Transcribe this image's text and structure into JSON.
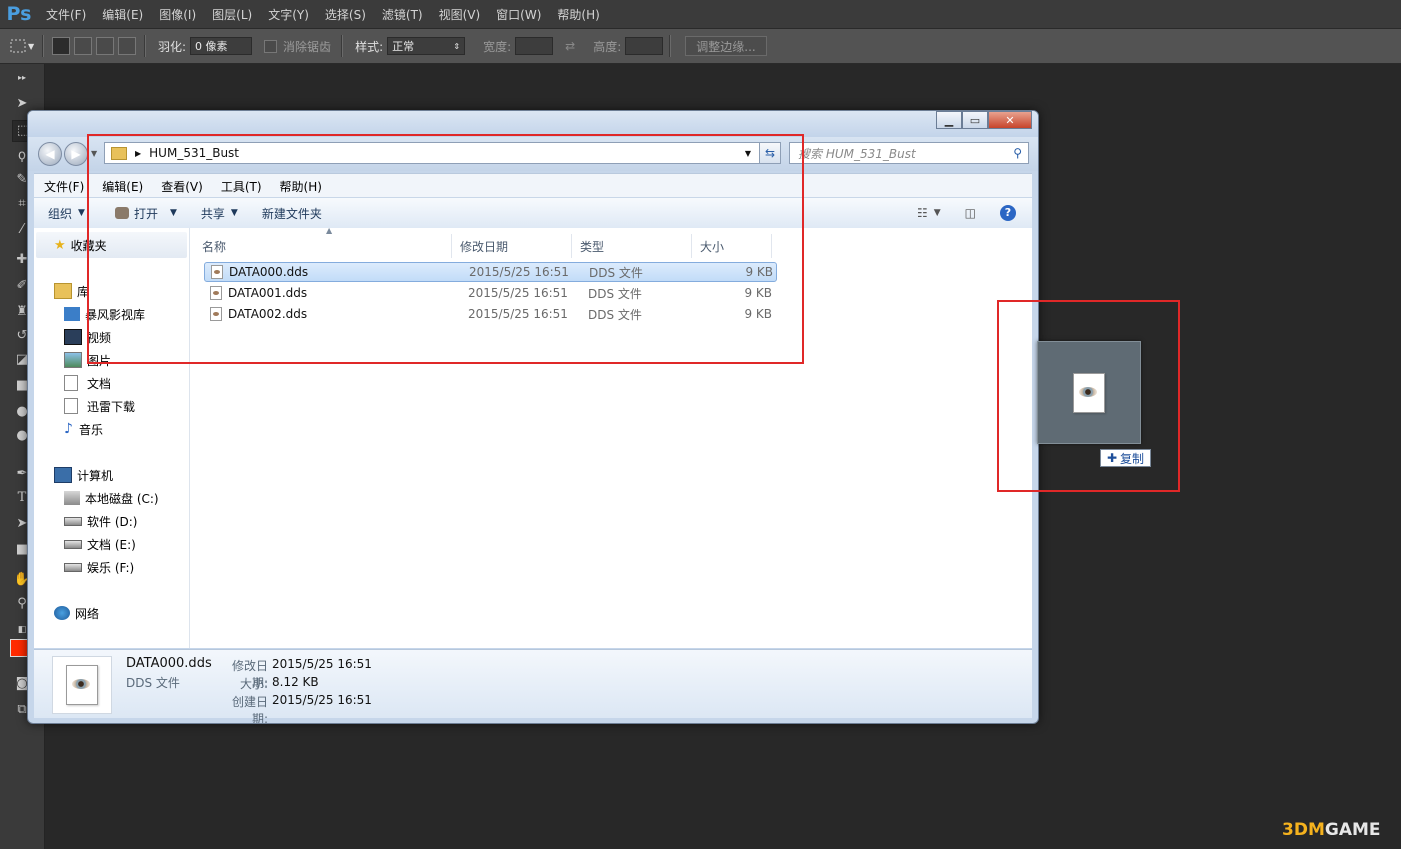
{
  "photoshop": {
    "logo": "Ps",
    "menu": [
      "文件(F)",
      "编辑(E)",
      "图像(I)",
      "图层(L)",
      "文字(Y)",
      "选择(S)",
      "滤镜(T)",
      "视图(V)",
      "窗口(W)",
      "帮助(H)"
    ],
    "options": {
      "feather_label": "羽化:",
      "feather_value": "0 像素",
      "antialias_label": "消除锯齿",
      "style_label": "样式:",
      "style_value": "正常",
      "width_label": "宽度:",
      "height_label": "高度:",
      "refine_edge_button": "调整边缘..."
    }
  },
  "explorer": {
    "address": "HUM_531_Bust",
    "search_placeholder": "搜索 HUM_531_Bust",
    "menu": [
      "文件(F)",
      "编辑(E)",
      "查看(V)",
      "工具(T)",
      "帮助(H)"
    ],
    "commands": {
      "organize": "组织",
      "open": "打开",
      "share": "共享",
      "new_folder": "新建文件夹"
    },
    "nav": {
      "favorites": "收藏夹",
      "library": "库",
      "library_items": [
        "暴风影视库",
        "视频",
        "图片",
        "文档",
        "迅雷下载",
        "音乐"
      ],
      "computer": "计算机",
      "drives": [
        "本地磁盘 (C:)",
        "软件 (D:)",
        "文档 (E:)",
        "娱乐 (F:)"
      ],
      "network": "网络"
    },
    "columns": [
      "名称",
      "修改日期",
      "类型",
      "大小"
    ],
    "files": [
      {
        "name": "DATA000.dds",
        "date": "2015/5/25 16:51",
        "type": "DDS 文件",
        "size": "9 KB"
      },
      {
        "name": "DATA001.dds",
        "date": "2015/5/25 16:51",
        "type": "DDS 文件",
        "size": "9 KB"
      },
      {
        "name": "DATA002.dds",
        "date": "2015/5/25 16:51",
        "type": "DDS 文件",
        "size": "9 KB"
      }
    ],
    "details": {
      "name": "DATA000.dds",
      "type": "DDS 文件",
      "modified_label": "修改日期:",
      "modified": "2015/5/25 16:51",
      "size_label": "大小:",
      "size": "8.12 KB",
      "created_label": "创建日期:",
      "created": "2015/5/25 16:51"
    }
  },
  "drag": {
    "copy_label": "复制"
  },
  "watermark": {
    "logo": "3DM",
    "text": "GAME"
  },
  "colors": {
    "ps_bg": "#282828",
    "highlight": "#e02828",
    "fg_swatch": "#ff2a00"
  }
}
